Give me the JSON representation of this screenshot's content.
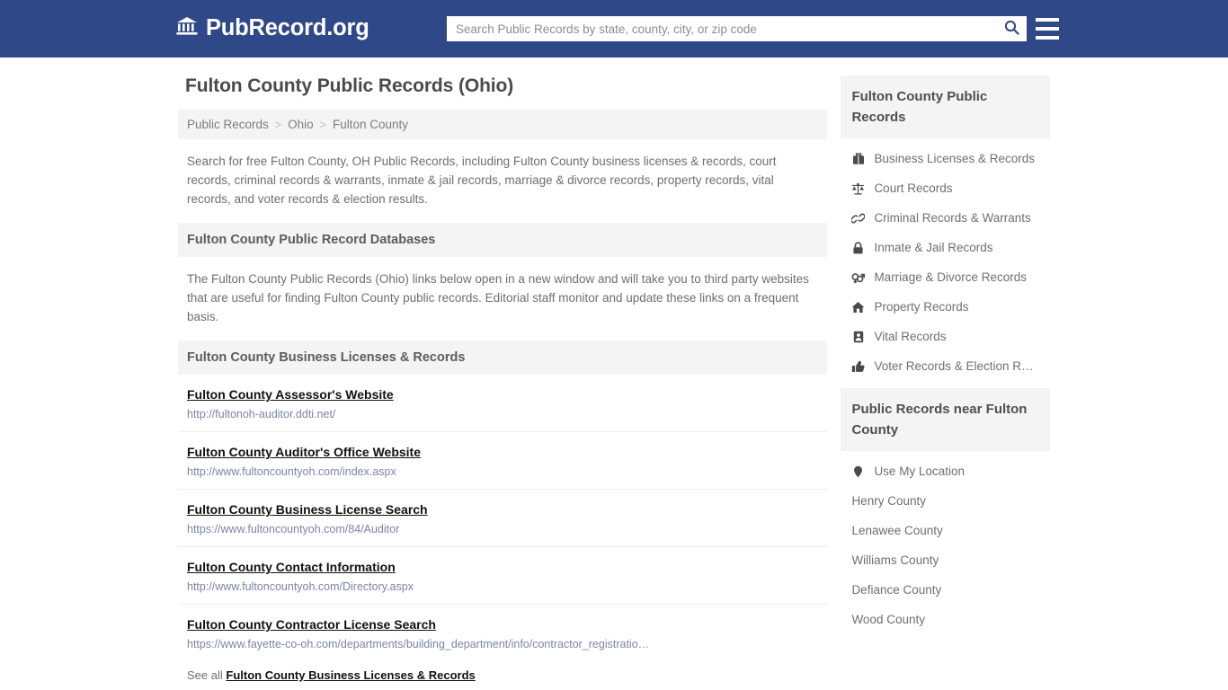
{
  "header": {
    "brand_name": "PubRecord.org",
    "brand_icon": "bank-building-icon",
    "search_placeholder": "Search Public Records by state, county, city, or zip code",
    "search_value": "",
    "search_icon": "search-icon",
    "menu_icon": "hamburger-menu-icon",
    "background_color": "#2f4888"
  },
  "page": {
    "title": "Fulton County Public Records (Ohio)"
  },
  "breadcrumb": {
    "separator": ">",
    "items": [
      {
        "label": "Public Records"
      },
      {
        "label": "Ohio"
      },
      {
        "label": "Fulton County"
      }
    ]
  },
  "intro": {
    "text": "Search for free Fulton County, OH Public Records, including Fulton County business licenses & records, court records, criminal records & warrants, inmate & jail records, marriage & divorce records, property records, vital records, and voter records & election results."
  },
  "databases_section": {
    "heading": "Fulton County Public Record Databases",
    "note": "The Fulton County Public Records (Ohio) links below open in a new window and will take you to third party websites that are useful for finding Fulton County public records. Editorial staff monitor and update these links on a frequent basis."
  },
  "business_section": {
    "heading": "Fulton County Business Licenses & Records",
    "links": [
      {
        "title": "Fulton County Assessor's Website",
        "url": "http://fultonoh-auditor.ddti.net/"
      },
      {
        "title": "Fulton County Auditor's Office Website",
        "url": "http://www.fultoncountyoh.com/index.aspx"
      },
      {
        "title": "Fulton County Business License Search",
        "url": "https://www.fultoncountyoh.com/84/Auditor"
      },
      {
        "title": "Fulton County Contact Information",
        "url": "http://www.fultoncountyoh.com/Directory.aspx"
      },
      {
        "title": "Fulton County Contractor License Search",
        "url": "https://www.fayette-co-oh.com/departments/building_department/info/contractor_registratio…"
      }
    ],
    "see_all_prefix": "See all",
    "see_all_link": "Fulton County Business Licenses & Records"
  },
  "sidebar": {
    "records_box": {
      "heading": "Fulton County Public Records",
      "items": [
        {
          "label": "Business Licenses & Records",
          "icon": "briefcase-icon"
        },
        {
          "label": "Court Records",
          "icon": "balance-scale-icon"
        },
        {
          "label": "Criminal Records & Warrants",
          "icon": "chain-link-icon"
        },
        {
          "label": "Inmate & Jail Records",
          "icon": "lock-icon"
        },
        {
          "label": "Marriage & Divorce Records",
          "icon": "venus-mars-icon"
        },
        {
          "label": "Property Records",
          "icon": "home-icon"
        },
        {
          "label": "Vital Records",
          "icon": "id-badge-icon"
        },
        {
          "label": "Voter Records & Election R…",
          "icon": "thumbs-up-icon"
        }
      ]
    },
    "nearby_box": {
      "heading": "Public Records near Fulton County",
      "items": [
        {
          "label": "Use My Location",
          "icon": "map-pin-icon"
        },
        {
          "label": "Henry County",
          "icon": ""
        },
        {
          "label": "Lenawee County",
          "icon": ""
        },
        {
          "label": "Williams County",
          "icon": ""
        },
        {
          "label": "Defiance County",
          "icon": ""
        },
        {
          "label": "Wood County",
          "icon": ""
        }
      ]
    }
  }
}
